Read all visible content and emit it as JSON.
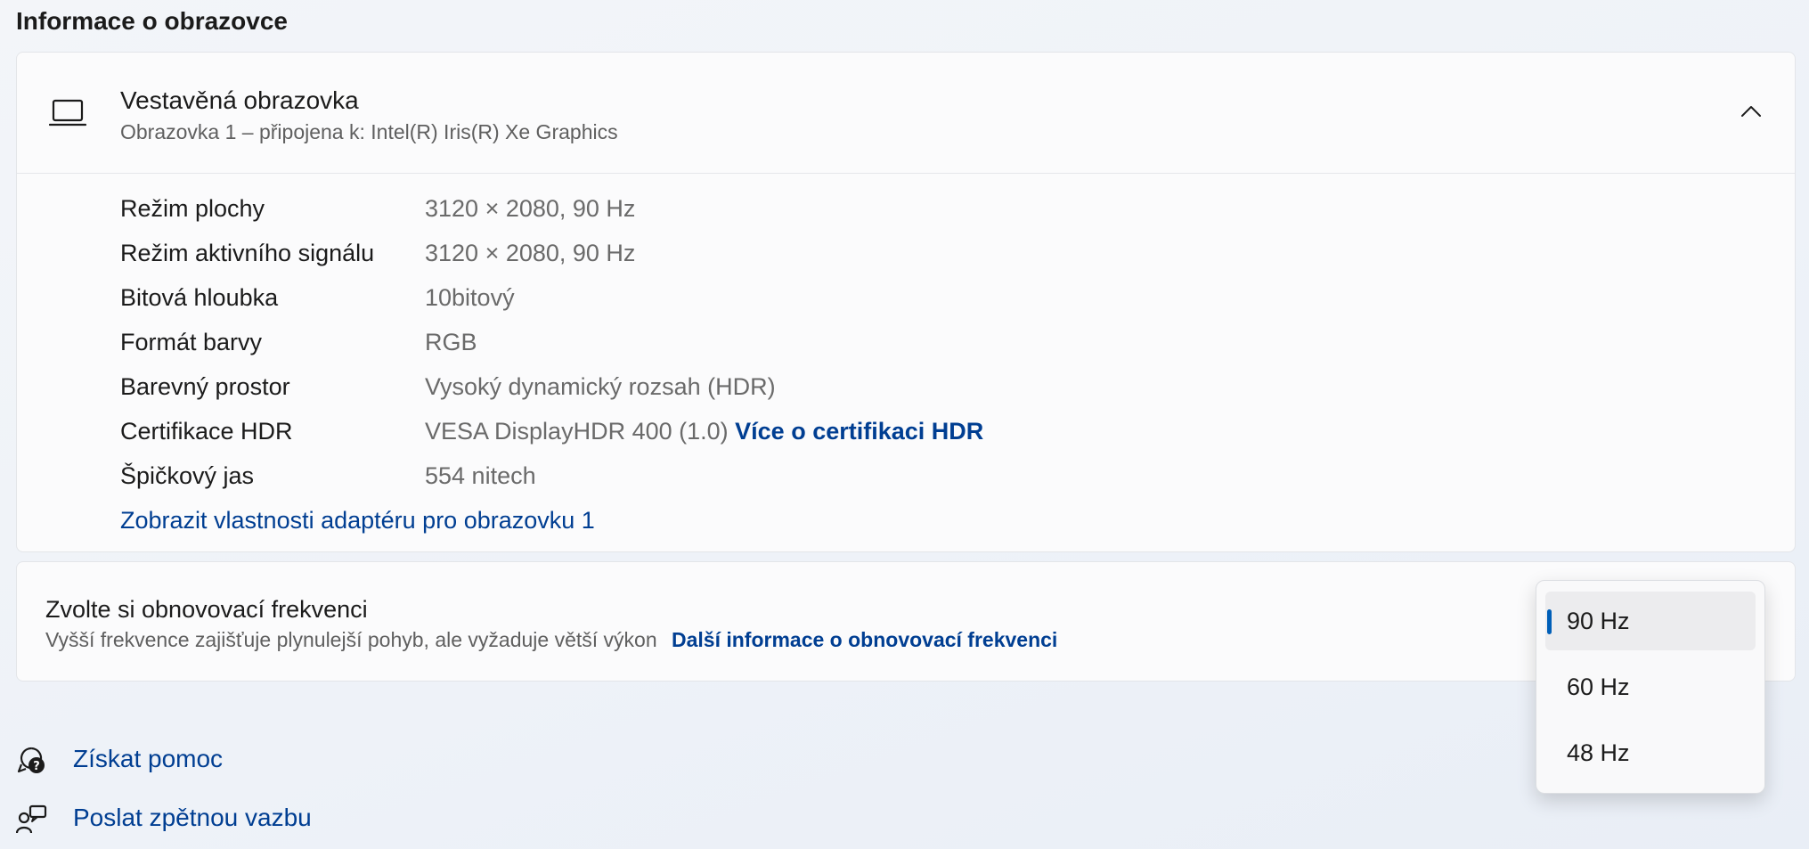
{
  "section_title": "Informace o obrazovce",
  "display": {
    "title": "Vestavěná obrazovka",
    "subtitle": "Obrazovka 1 – připojena k: Intel(R) Iris(R) Xe Graphics",
    "properties": [
      {
        "label": "Režim plochy",
        "value": "3120 × 2080, 90 Hz"
      },
      {
        "label": "Režim aktivního signálu",
        "value": "3120 × 2080, 90 Hz"
      },
      {
        "label": "Bitová hloubka",
        "value": "10bitový"
      },
      {
        "label": "Formát barvy",
        "value": "RGB"
      },
      {
        "label": "Barevný prostor",
        "value": "Vysoký dynamický rozsah (HDR)"
      },
      {
        "label": "Certifikace HDR",
        "value": "VESA DisplayHDR 400 (1.0)",
        "link": "Více o certifikaci HDR"
      },
      {
        "label": "Špičkový jas",
        "value": "554 nitech"
      }
    ],
    "adapter_link": "Zobrazit vlastnosti adaptéru pro obrazovku 1"
  },
  "refresh": {
    "title": "Zvolte si obnovovací frekvenci",
    "subtitle": "Vyšší frekvence zajišťuje plynulejší pohyb, ale vyžaduje větší výkon",
    "link": "Další informace o obnovovací frekvenci",
    "options": [
      "90 Hz",
      "60 Hz",
      "48 Hz"
    ],
    "selected": "90 Hz"
  },
  "footer": {
    "help": "Získat pomoc",
    "feedback": "Poslat zpětnou vazbu"
  },
  "icons": {
    "display": "laptop-icon",
    "collapse": "chevron-up-icon",
    "help": "help-icon",
    "feedback": "feedback-icon"
  },
  "colors": {
    "link": "#003e92",
    "accent": "#005fb8"
  }
}
